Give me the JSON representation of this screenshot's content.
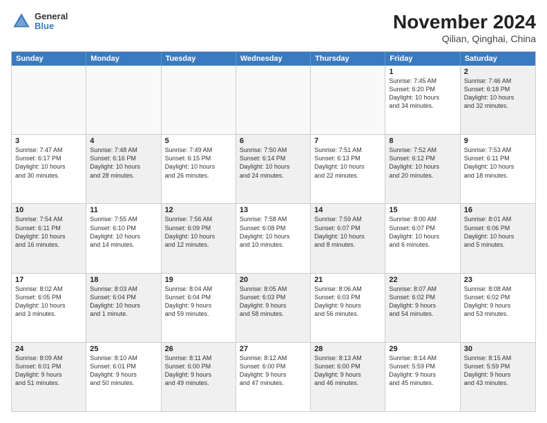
{
  "header": {
    "logo": {
      "line1": "General",
      "line2": "Blue"
    },
    "title": "November 2024",
    "subtitle": "Qilian, Qinghai, China"
  },
  "days_of_week": [
    "Sunday",
    "Monday",
    "Tuesday",
    "Wednesday",
    "Thursday",
    "Friday",
    "Saturday"
  ],
  "weeks": [
    {
      "cells": [
        {
          "day": "",
          "empty": true
        },
        {
          "day": "",
          "empty": true
        },
        {
          "day": "",
          "empty": true
        },
        {
          "day": "",
          "empty": true
        },
        {
          "day": "",
          "empty": true
        },
        {
          "day": "1",
          "lines": [
            "Sunrise: 7:45 AM",
            "Sunset: 6:20 PM",
            "Daylight: 10 hours",
            "and 34 minutes."
          ]
        },
        {
          "day": "2",
          "shaded": true,
          "lines": [
            "Sunrise: 7:46 AM",
            "Sunset: 6:18 PM",
            "Daylight: 10 hours",
            "and 32 minutes."
          ]
        }
      ]
    },
    {
      "cells": [
        {
          "day": "3",
          "lines": [
            "Sunrise: 7:47 AM",
            "Sunset: 6:17 PM",
            "Daylight: 10 hours",
            "and 30 minutes."
          ]
        },
        {
          "day": "4",
          "shaded": true,
          "lines": [
            "Sunrise: 7:48 AM",
            "Sunset: 6:16 PM",
            "Daylight: 10 hours",
            "and 28 minutes."
          ]
        },
        {
          "day": "5",
          "lines": [
            "Sunrise: 7:49 AM",
            "Sunset: 6:15 PM",
            "Daylight: 10 hours",
            "and 26 minutes."
          ]
        },
        {
          "day": "6",
          "shaded": true,
          "lines": [
            "Sunrise: 7:50 AM",
            "Sunset: 6:14 PM",
            "Daylight: 10 hours",
            "and 24 minutes."
          ]
        },
        {
          "day": "7",
          "lines": [
            "Sunrise: 7:51 AM",
            "Sunset: 6:13 PM",
            "Daylight: 10 hours",
            "and 22 minutes."
          ]
        },
        {
          "day": "8",
          "shaded": true,
          "lines": [
            "Sunrise: 7:52 AM",
            "Sunset: 6:12 PM",
            "Daylight: 10 hours",
            "and 20 minutes."
          ]
        },
        {
          "day": "9",
          "lines": [
            "Sunrise: 7:53 AM",
            "Sunset: 6:11 PM",
            "Daylight: 10 hours",
            "and 18 minutes."
          ]
        }
      ]
    },
    {
      "cells": [
        {
          "day": "10",
          "shaded": true,
          "lines": [
            "Sunrise: 7:54 AM",
            "Sunset: 6:11 PM",
            "Daylight: 10 hours",
            "and 16 minutes."
          ]
        },
        {
          "day": "11",
          "lines": [
            "Sunrise: 7:55 AM",
            "Sunset: 6:10 PM",
            "Daylight: 10 hours",
            "and 14 minutes."
          ]
        },
        {
          "day": "12",
          "shaded": true,
          "lines": [
            "Sunrise: 7:56 AM",
            "Sunset: 6:09 PM",
            "Daylight: 10 hours",
            "and 12 minutes."
          ]
        },
        {
          "day": "13",
          "lines": [
            "Sunrise: 7:58 AM",
            "Sunset: 6:08 PM",
            "Daylight: 10 hours",
            "and 10 minutes."
          ]
        },
        {
          "day": "14",
          "shaded": true,
          "lines": [
            "Sunrise: 7:59 AM",
            "Sunset: 6:07 PM",
            "Daylight: 10 hours",
            "and 8 minutes."
          ]
        },
        {
          "day": "15",
          "lines": [
            "Sunrise: 8:00 AM",
            "Sunset: 6:07 PM",
            "Daylight: 10 hours",
            "and 6 minutes."
          ]
        },
        {
          "day": "16",
          "shaded": true,
          "lines": [
            "Sunrise: 8:01 AM",
            "Sunset: 6:06 PM",
            "Daylight: 10 hours",
            "and 5 minutes."
          ]
        }
      ]
    },
    {
      "cells": [
        {
          "day": "17",
          "lines": [
            "Sunrise: 8:02 AM",
            "Sunset: 6:05 PM",
            "Daylight: 10 hours",
            "and 3 minutes."
          ]
        },
        {
          "day": "18",
          "shaded": true,
          "lines": [
            "Sunrise: 8:03 AM",
            "Sunset: 6:04 PM",
            "Daylight: 10 hours",
            "and 1 minute."
          ]
        },
        {
          "day": "19",
          "lines": [
            "Sunrise: 8:04 AM",
            "Sunset: 6:04 PM",
            "Daylight: 9 hours",
            "and 59 minutes."
          ]
        },
        {
          "day": "20",
          "shaded": true,
          "lines": [
            "Sunrise: 8:05 AM",
            "Sunset: 6:03 PM",
            "Daylight: 9 hours",
            "and 58 minutes."
          ]
        },
        {
          "day": "21",
          "lines": [
            "Sunrise: 8:06 AM",
            "Sunset: 6:03 PM",
            "Daylight: 9 hours",
            "and 56 minutes."
          ]
        },
        {
          "day": "22",
          "shaded": true,
          "lines": [
            "Sunrise: 8:07 AM",
            "Sunset: 6:02 PM",
            "Daylight: 9 hours",
            "and 54 minutes."
          ]
        },
        {
          "day": "23",
          "lines": [
            "Sunrise: 8:08 AM",
            "Sunset: 6:02 PM",
            "Daylight: 9 hours",
            "and 53 minutes."
          ]
        }
      ]
    },
    {
      "cells": [
        {
          "day": "24",
          "shaded": true,
          "lines": [
            "Sunrise: 8:09 AM",
            "Sunset: 6:01 PM",
            "Daylight: 9 hours",
            "and 51 minutes."
          ]
        },
        {
          "day": "25",
          "lines": [
            "Sunrise: 8:10 AM",
            "Sunset: 6:01 PM",
            "Daylight: 9 hours",
            "and 50 minutes."
          ]
        },
        {
          "day": "26",
          "shaded": true,
          "lines": [
            "Sunrise: 8:11 AM",
            "Sunset: 6:00 PM",
            "Daylight: 9 hours",
            "and 49 minutes."
          ]
        },
        {
          "day": "27",
          "lines": [
            "Sunrise: 8:12 AM",
            "Sunset: 6:00 PM",
            "Daylight: 9 hours",
            "and 47 minutes."
          ]
        },
        {
          "day": "28",
          "shaded": true,
          "lines": [
            "Sunrise: 8:13 AM",
            "Sunset: 6:00 PM",
            "Daylight: 9 hours",
            "and 46 minutes."
          ]
        },
        {
          "day": "29",
          "lines": [
            "Sunrise: 8:14 AM",
            "Sunset: 5:59 PM",
            "Daylight: 9 hours",
            "and 45 minutes."
          ]
        },
        {
          "day": "30",
          "shaded": true,
          "lines": [
            "Sunrise: 8:15 AM",
            "Sunset: 5:59 PM",
            "Daylight: 9 hours",
            "and 43 minutes."
          ]
        }
      ]
    }
  ]
}
